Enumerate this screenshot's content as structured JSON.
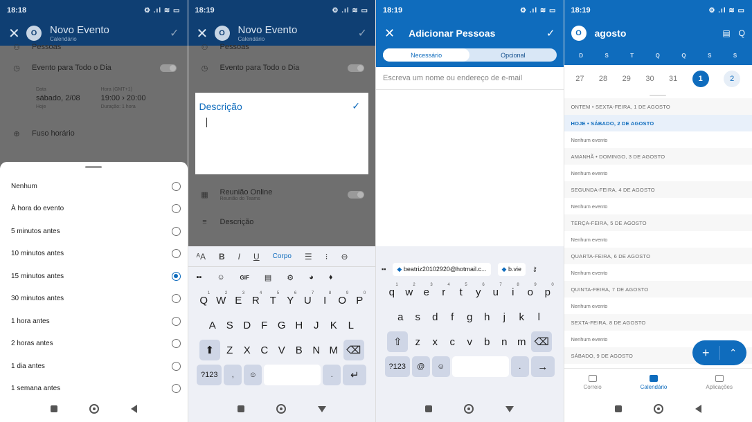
{
  "panels": {
    "p1": {
      "time": "18:18",
      "status_icons": "⚙ .ıl ≋ ▭",
      "title": "Novo Evento",
      "subtitle": "Calendário",
      "people_label": "Pessoas",
      "allday_label": "Evento para Todo o Dia",
      "date_label": "Data",
      "date_value": "sábado, 2/08",
      "date_sub": "Hoje",
      "hour_label": "Hora (GMT+1)",
      "hour_value": "19:00 › 20:00",
      "hour_sub": "Duração: 1 hora",
      "timezone_label": "Fuso horário",
      "options": [
        "Nenhum",
        "À hora do evento",
        "5 minutos antes",
        "10 minutos antes",
        "15 minutos antes",
        "30 minutos antes",
        "1 hora antes",
        "2 horas antes",
        "1 dia antes",
        "1 semana antes"
      ],
      "selected_index": 4
    },
    "p2": {
      "time": "18:19",
      "status_icons": "⚙ .ıl ≋ ▭",
      "title": "Novo Evento",
      "subtitle": "Calendário",
      "people_label": "Pessoas",
      "allday_label": "Evento para Todo o Dia",
      "desc_title": "Descrição",
      "online_label": "Reunião Online",
      "online_sub": "Reunião do Teams",
      "desc_label": "Descrição",
      "fmt_style": "Corpo"
    },
    "p3": {
      "time": "18:19",
      "status_icons": "⚙ .ıl ≋ ▭",
      "title": "Adicionar Pessoas",
      "seg_required": "Necessário",
      "seg_optional": "Opcional",
      "input_placeholder": "Escreva um nome ou endereço de e-mail",
      "suggest_email": "beatriz20102920@hotmail.c...",
      "suggest_second": "b.vie"
    },
    "p4": {
      "time": "18:19",
      "status_icons": "⚙ .ıl ≋ ▭",
      "month": "agosto",
      "week_letters": [
        "D",
        "S",
        "T",
        "Q",
        "Q",
        "S",
        "S"
      ],
      "days": [
        "27",
        "28",
        "29",
        "30",
        "31",
        "1",
        "2"
      ],
      "agenda": [
        {
          "type": "h",
          "text": "ONTEM • SEXTA-FEIRA, 1 DE AGOSTO"
        },
        {
          "type": "h today",
          "text": "HOJE • SÁBADO, 2 DE AGOSTO"
        },
        {
          "type": "e",
          "text": "Nenhum evento"
        },
        {
          "type": "h",
          "text": "AMANHÃ • DOMINGO, 3 DE AGOSTO"
        },
        {
          "type": "e",
          "text": "Nenhum evento"
        },
        {
          "type": "h",
          "text": "SEGUNDA-FEIRA, 4 DE AGOSTO"
        },
        {
          "type": "e",
          "text": "Nenhum evento"
        },
        {
          "type": "h",
          "text": "TERÇA-FEIRA, 5 DE AGOSTO"
        },
        {
          "type": "e",
          "text": "Nenhum evento"
        },
        {
          "type": "h",
          "text": "QUARTA-FEIRA, 6 DE AGOSTO"
        },
        {
          "type": "e",
          "text": "Nenhum evento"
        },
        {
          "type": "h",
          "text": "QUINTA-FEIRA, 7 DE AGOSTO"
        },
        {
          "type": "e",
          "text": "Nenhum evento"
        },
        {
          "type": "h",
          "text": "SEXTA-FEIRA, 8 DE AGOSTO"
        },
        {
          "type": "e",
          "text": "Nenhum evento"
        },
        {
          "type": "h",
          "text": "SÁBADO, 9 DE AGOSTO"
        }
      ],
      "tabs": [
        "Correio",
        "Calendário",
        "Aplicações"
      ]
    }
  },
  "keyboard": {
    "row1": [
      "Q",
      "W",
      "E",
      "R",
      "T",
      "Y",
      "U",
      "I",
      "O",
      "P"
    ],
    "row1_sup": [
      "1",
      "2",
      "3",
      "4",
      "5",
      "6",
      "7",
      "8",
      "9",
      "0"
    ],
    "row2": [
      "A",
      "S",
      "D",
      "F",
      "G",
      "H",
      "J",
      "K",
      "L"
    ],
    "row3": [
      "Z",
      "X",
      "C",
      "V",
      "B",
      "N",
      "M"
    ],
    "row1_lower": [
      "q",
      "w",
      "e",
      "r",
      "t",
      "y",
      "u",
      "i",
      "o",
      "p"
    ],
    "row2_lower": [
      "a",
      "s",
      "d",
      "f",
      "g",
      "h",
      "j",
      "k",
      "l"
    ],
    "row3_lower": [
      "z",
      "x",
      "c",
      "v",
      "b",
      "n",
      "m"
    ],
    "num_key": "?123",
    "comma": ",",
    "at": "@",
    "period": ".",
    "gif": "GIF"
  },
  "colors": {
    "brand_blue": "#0f6cbd",
    "dark_header": "#0f3f73"
  }
}
